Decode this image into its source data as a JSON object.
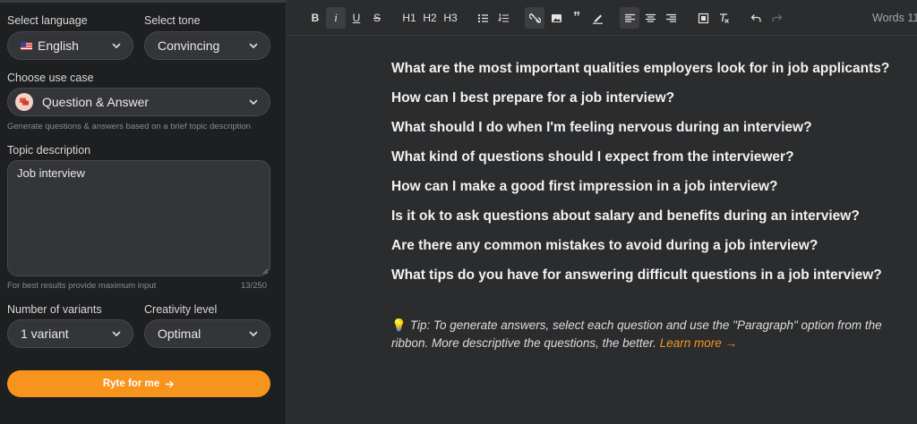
{
  "sidebar": {
    "language": {
      "label": "Select language",
      "value": "English"
    },
    "tone": {
      "label": "Select tone",
      "value": "Convincing"
    },
    "use_case": {
      "label": "Choose use case",
      "value": "Question & Answer",
      "hint": "Generate questions & answers based on a brief topic description"
    },
    "topic": {
      "label": "Topic description",
      "value": "Job interview",
      "hint": "For best results provide maximum input",
      "counter": "13/250"
    },
    "variants": {
      "label": "Number of variants",
      "value": "1 variant"
    },
    "creativity": {
      "label": "Creativity level",
      "value": "Optimal"
    },
    "submit_label": "Ryte for me"
  },
  "toolbar": {
    "bold": "B",
    "italic": "i",
    "underline": "U",
    "strike": "S",
    "h1": "H1",
    "h2": "H2",
    "h3": "H3",
    "words": "Words 11"
  },
  "editor": {
    "questions": [
      "What are the most important qualities employers look for in job applicants?",
      "How can I best prepare for a job interview?",
      "What should I do when I'm feeling nervous during an interview?",
      "What kind of questions should I expect from the interviewer?",
      "How can I make a good first impression in a job interview?",
      "Is it ok to ask questions about salary and benefits during an interview?",
      "Are there any common mistakes to avoid during a job interview?",
      "What tips do you have for answering difficult questions in a job interview?"
    ],
    "tip": {
      "text": "Tip: To generate answers, select each question and use the \"Paragraph\" option from the ribbon. More descriptive the questions, the better.",
      "link": "Learn more →"
    }
  },
  "colors": {
    "accent": "#f7941d",
    "sidebar_bg": "#1e1f21",
    "editor_bg": "#2b2c2e"
  }
}
